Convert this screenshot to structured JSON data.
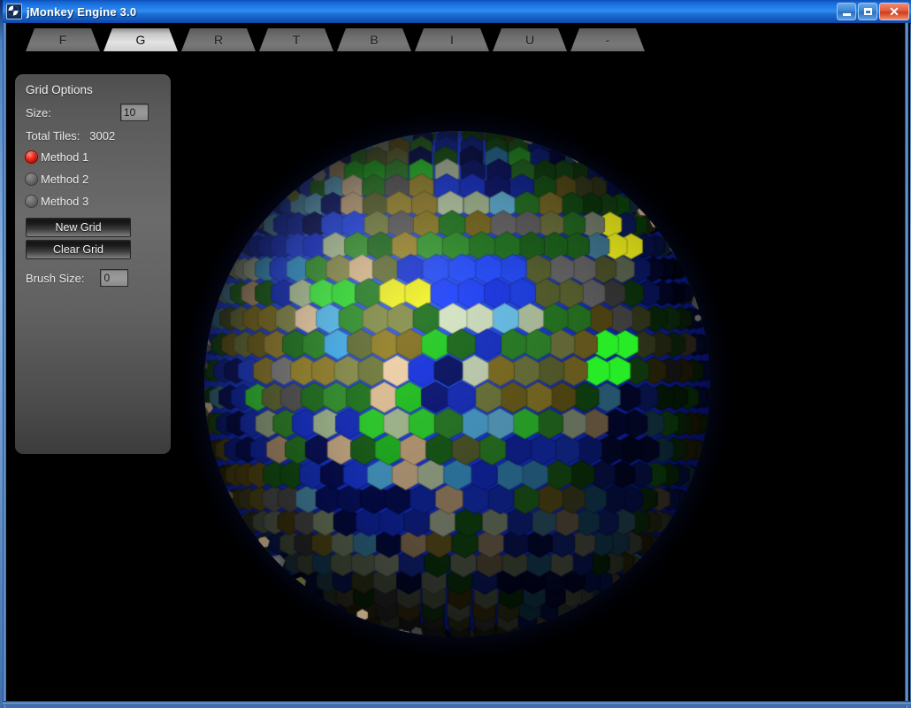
{
  "window": {
    "title": "jMonkey Engine 3.0",
    "icon": "jmonkey-logo-icon",
    "controls": {
      "minimize_label": "Minimize",
      "maximize_label": "Maximize",
      "close_label": "Close"
    }
  },
  "tabs": [
    {
      "label": "F",
      "selected": false
    },
    {
      "label": "G",
      "selected": true
    },
    {
      "label": "R",
      "selected": false
    },
    {
      "label": "T",
      "selected": false
    },
    {
      "label": "B",
      "selected": false
    },
    {
      "label": "I",
      "selected": false
    },
    {
      "label": "U",
      "selected": false
    },
    {
      "label": "-",
      "selected": false
    }
  ],
  "panel": {
    "title": "Grid Options",
    "size": {
      "label": "Size:",
      "value": "10"
    },
    "total_tiles": {
      "label": "Total Tiles:",
      "value": "3002",
      "text": "Total Tiles:   3002"
    },
    "methods": [
      {
        "label": "Method 1",
        "selected": true
      },
      {
        "label": "Method 2",
        "selected": false
      },
      {
        "label": "Method 3",
        "selected": false
      }
    ],
    "buttons": [
      {
        "label": "New Grid",
        "name": "new-grid-button"
      },
      {
        "label": "Clear Grid",
        "name": "clear-grid-button"
      }
    ],
    "brush_size": {
      "label": "Brush Size:",
      "value": "0"
    }
  },
  "viewport": {
    "background_color": "#000000",
    "object": "hex-tiled-planet",
    "ocean_color": "#1a3fdd",
    "shallow_color": "#4fb4ef",
    "grass_color": "#2f8f2f",
    "highlight_color": "#ffff00"
  },
  "colors": {
    "titlebar_blue": "#1f7ae8",
    "panel_gray": "#6b6b6b",
    "tab_selected": "#e2e2e2",
    "radio_on_red": "#ef2b1c",
    "close_red": "#e05c3c"
  }
}
